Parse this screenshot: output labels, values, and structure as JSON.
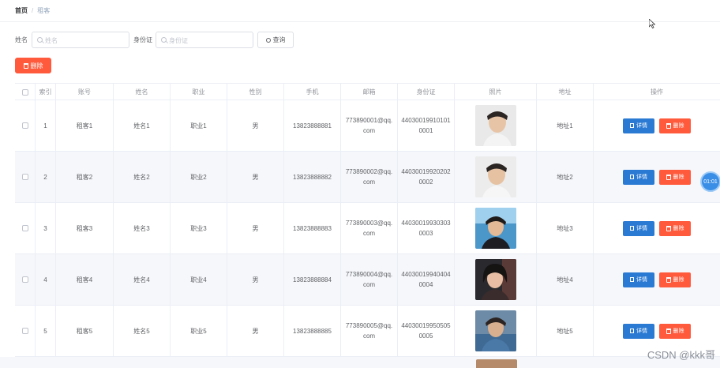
{
  "breadcrumb": {
    "home": "首页",
    "separator": "/",
    "current": "租客"
  },
  "search": {
    "name_label": "姓名",
    "name_placeholder": "姓名",
    "id_label": "身份证",
    "id_placeholder": "身份证",
    "query_button": "查询"
  },
  "toolbar": {
    "delete_label": "删除"
  },
  "table": {
    "headers": {
      "index": "索引",
      "account": "账号",
      "name": "姓名",
      "job": "职业",
      "gender": "性别",
      "phone": "手机",
      "email": "邮箱",
      "idcard": "身份证",
      "photo": "照片",
      "address": "地址",
      "ops": "操作"
    },
    "rows": [
      {
        "index": "1",
        "account": "租客1",
        "name": "姓名1",
        "job": "职业1",
        "gender": "男",
        "phone": "13823888881",
        "email": "773890001@qq.com",
        "idcard": "440300199101010001",
        "address": "地址1",
        "detail": "详情",
        "delete": "删除"
      },
      {
        "index": "2",
        "account": "租客2",
        "name": "姓名2",
        "job": "职业2",
        "gender": "男",
        "phone": "13823888882",
        "email": "773890002@qq.com",
        "idcard": "440300199202020002",
        "address": "地址2",
        "detail": "详情",
        "delete": "删除"
      },
      {
        "index": "3",
        "account": "租客3",
        "name": "姓名3",
        "job": "职业3",
        "gender": "男",
        "phone": "13823888883",
        "email": "773890003@qq.com",
        "idcard": "440300199303030003",
        "address": "地址3",
        "detail": "详情",
        "delete": "删除"
      },
      {
        "index": "4",
        "account": "租客4",
        "name": "姓名4",
        "job": "职业4",
        "gender": "男",
        "phone": "13823888884",
        "email": "773890004@qq.com",
        "idcard": "440300199404040004",
        "address": "地址4",
        "detail": "详情",
        "delete": "删除"
      },
      {
        "index": "5",
        "account": "租客5",
        "name": "姓名5",
        "job": "职业5",
        "gender": "男",
        "phone": "13823888885",
        "email": "773890005@qq.com",
        "idcard": "440300199505050005",
        "address": "地址5",
        "detail": "详情",
        "delete": "删除"
      }
    ]
  },
  "timer": "01:01",
  "watermark": "CSDN @kkk哥",
  "colors": {
    "primary": "#2a7ad3",
    "danger": "#ff5a3c",
    "stripe": "#f5f7fa"
  }
}
